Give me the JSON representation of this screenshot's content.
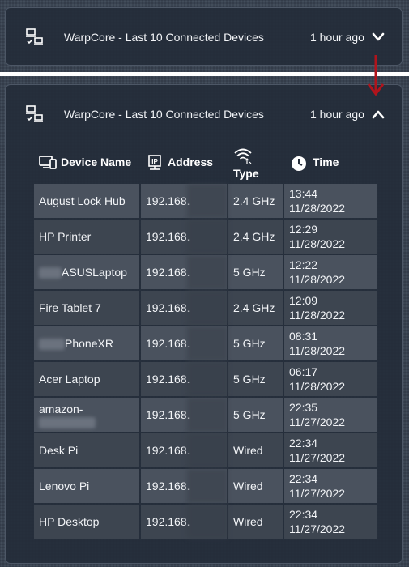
{
  "top_card": {
    "title": "WarpCore - Last 10 Connected Devices",
    "updated": "1 hour ago"
  },
  "main_card": {
    "title": "WarpCore - Last 10 Connected Devices",
    "updated": "1 hour ago"
  },
  "columns": {
    "device_name": "Device Name",
    "address": "Address",
    "type": "Type",
    "time": "Time"
  },
  "rows": [
    {
      "name": "August Lock Hub",
      "ip": "192.168.",
      "type": "2.4 GHz",
      "time": "13:44",
      "date": "11/28/2022"
    },
    {
      "name": "HP Printer",
      "ip": "192.168.",
      "type": "2.4 GHz",
      "time": "12:29",
      "date": "11/28/2022"
    },
    {
      "name": "ASUSLaptop",
      "ip": "192.168.",
      "type": "5 GHz",
      "time": "12:22",
      "date": "11/28/2022"
    },
    {
      "name": "Fire Tablet 7",
      "ip": "192.168.",
      "type": "2.4 GHz",
      "time": "12:09",
      "date": "11/28/2022"
    },
    {
      "name": "PhoneXR",
      "ip": "192.168.",
      "type": "5 GHz",
      "time": "08:31",
      "date": "11/28/2022"
    },
    {
      "name": "Acer Laptop",
      "ip": "192.168.",
      "type": "5 GHz",
      "time": "06:17",
      "date": "11/28/2022"
    },
    {
      "name": "amazon-",
      "ip": "192.168.",
      "type": "5 GHz",
      "time": "22:35",
      "date": "11/27/2022"
    },
    {
      "name": "Desk Pi",
      "ip": "192.168.",
      "type": "Wired",
      "time": "22:34",
      "date": "11/27/2022"
    },
    {
      "name": "Lenovo Pi",
      "ip": "192.168.",
      "type": "Wired",
      "time": "22:34",
      "date": "11/27/2022"
    },
    {
      "name": "HP Desktop",
      "ip": "192.168.",
      "type": "Wired",
      "time": "22:34",
      "date": "11/27/2022"
    }
  ],
  "colors": {
    "background": "#3a4452",
    "card": "#242d3a",
    "row_odd": "#4a525e",
    "row_even": "#3d4550",
    "annotation_arrow": "#b0141c"
  },
  "icons": {
    "header": "devices-icon",
    "expand": "chevron-down-icon",
    "collapse": "chevron-up-icon",
    "device_name": "device-list-icon",
    "address": "ip-icon",
    "type": "wifi-icon",
    "time": "clock-icon"
  }
}
